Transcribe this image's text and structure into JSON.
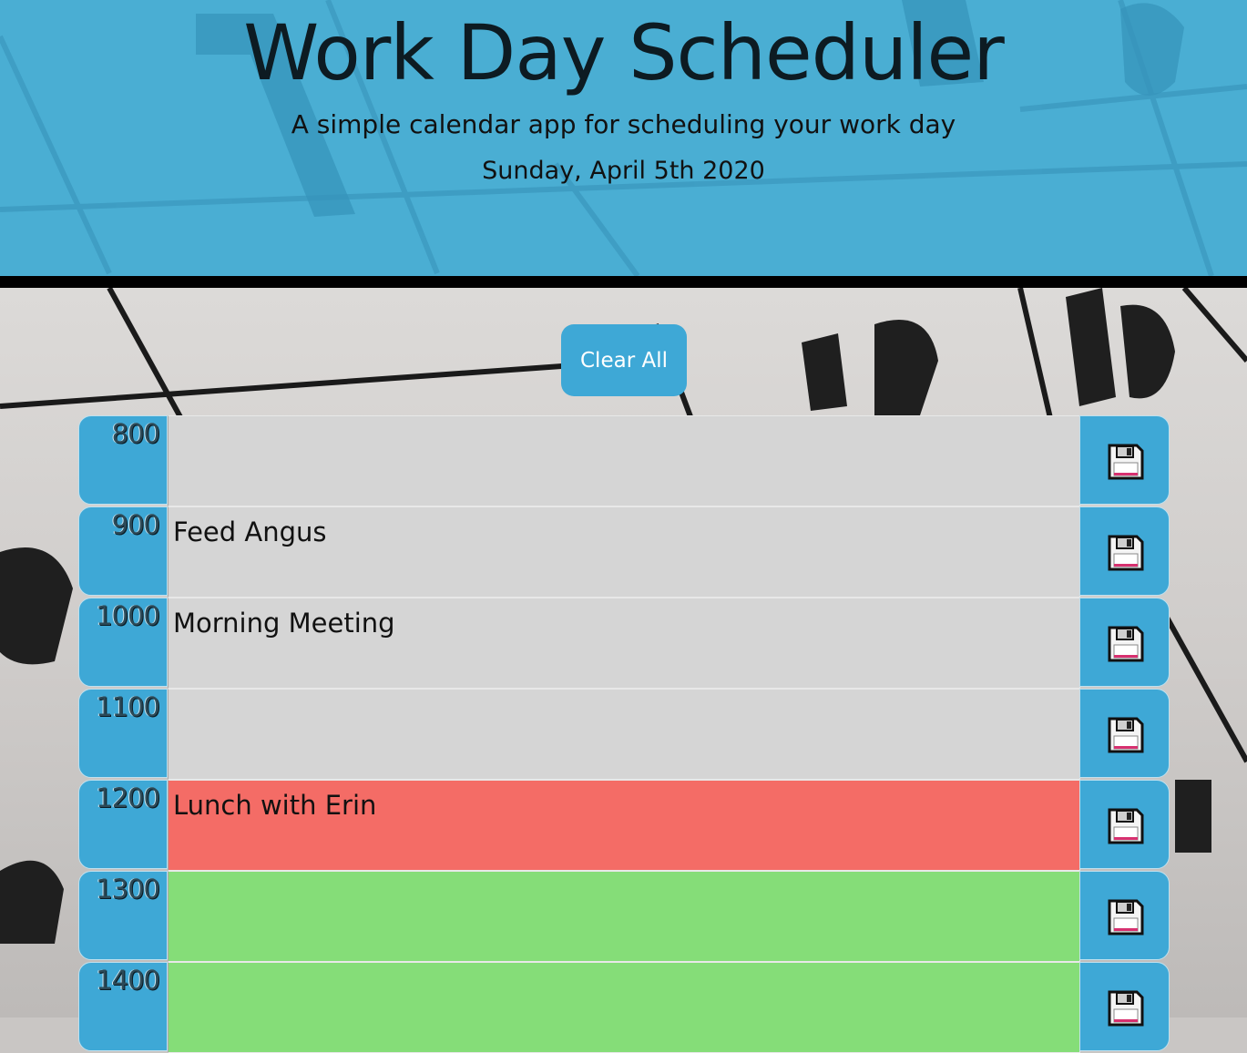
{
  "header": {
    "title": "Work Day Scheduler",
    "subtitle": "A simple calendar app for scheduling your work day",
    "date": "Sunday, April 5th 2020"
  },
  "actions": {
    "clear_label": "Clear All"
  },
  "colors": {
    "header_bg": "#4aaed3",
    "hour_block": "#3ea8d6",
    "past": "#d5d5d5",
    "present": "#f46c66",
    "future": "#85dd78"
  },
  "schedule": [
    {
      "hour": "800",
      "text": "",
      "state": "past"
    },
    {
      "hour": "900",
      "text": "Feed Angus",
      "state": "past"
    },
    {
      "hour": "1000",
      "text": "Morning Meeting",
      "state": "past"
    },
    {
      "hour": "1100",
      "text": "",
      "state": "past"
    },
    {
      "hour": "1200",
      "text": "Lunch with Erin",
      "state": "present"
    },
    {
      "hour": "1300",
      "text": "",
      "state": "future"
    },
    {
      "hour": "1400",
      "text": "",
      "state": "future"
    }
  ],
  "icons": {
    "save": "floppy-disk-icon"
  }
}
